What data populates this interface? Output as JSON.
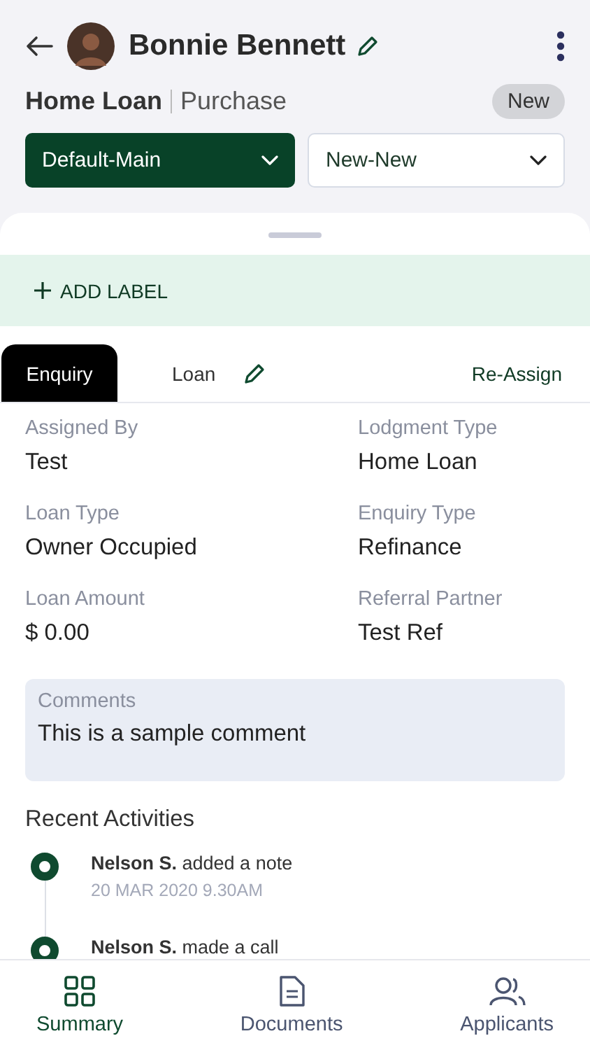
{
  "header": {
    "name": "Bonnie Bennett",
    "loan_title": "Home Loan",
    "loan_subtitle": "Purchase",
    "status_badge": "New"
  },
  "dropdowns": [
    {
      "value": "Default-Main",
      "kind": "filled"
    },
    {
      "value": "New-New",
      "kind": "outline"
    }
  ],
  "add_label": "ADD LABEL",
  "tabs": [
    {
      "label": "Enquiry",
      "selected": true,
      "editable": false
    },
    {
      "label": "Loan",
      "selected": false,
      "editable": true
    }
  ],
  "reassign": "Re-Assign",
  "fields": [
    {
      "label": "Assigned By",
      "value": "Test"
    },
    {
      "label": "Lodgment Type",
      "value": "Home Loan"
    },
    {
      "label": "Loan Type",
      "value": "Owner Occupied"
    },
    {
      "label": "Enquiry Type",
      "value": "Refinance"
    },
    {
      "label": "Loan Amount",
      "value": "$ 0.00"
    },
    {
      "label": "Referral Partner",
      "value": "Test Ref"
    }
  ],
  "comments": {
    "label": "Comments",
    "value": "This is a sample comment"
  },
  "activities_title": "Recent Activities",
  "activities": [
    {
      "text": "**Nelson S.** added a note",
      "time": "20 MAR 2020  9.30AM"
    },
    {
      "text": "**Nelson S.** made a call"
    }
  ],
  "bottom_nav": [
    {
      "label": "Summary",
      "selected": true
    },
    {
      "label": "Documents",
      "selected": false
    },
    {
      "label": "Applicants",
      "selected": false
    }
  ]
}
